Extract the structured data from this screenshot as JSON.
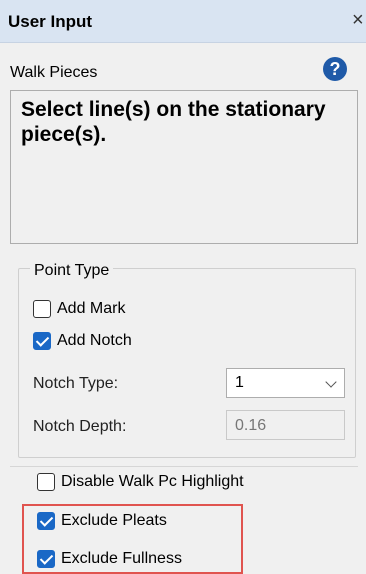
{
  "window": {
    "title": "User Input",
    "close_glyph": "×"
  },
  "section": {
    "label": "Walk Pieces",
    "help_glyph": "?"
  },
  "prompt": {
    "text": "Select line(s) on the stationary piece(s)."
  },
  "point_type": {
    "legend": "Point Type",
    "add_mark": {
      "label": "Add Mark",
      "checked": false
    },
    "add_notch": {
      "label": "Add Notch",
      "checked": true
    },
    "notch_type": {
      "label": "Notch Type:",
      "value": "1"
    },
    "notch_depth": {
      "label": "Notch Depth:",
      "value": "0.16"
    }
  },
  "options": {
    "disable_highlight": {
      "label": "Disable Walk Pc Highlight",
      "checked": false
    },
    "exclude_pleats": {
      "label": "Exclude Pleats",
      "checked": true
    },
    "exclude_fullness": {
      "label": "Exclude Fullness",
      "checked": true
    }
  },
  "colors": {
    "titlebar": "#d9e4f2",
    "checkbox_checked": "#1a68c6",
    "highlight": "#e0544f",
    "help_icon": "#1f5aa8"
  },
  "icons": {
    "help": "help-question-icon",
    "close": "close-icon",
    "dropdown": "chevron-down-icon",
    "checkmark": "checkmark-icon"
  }
}
